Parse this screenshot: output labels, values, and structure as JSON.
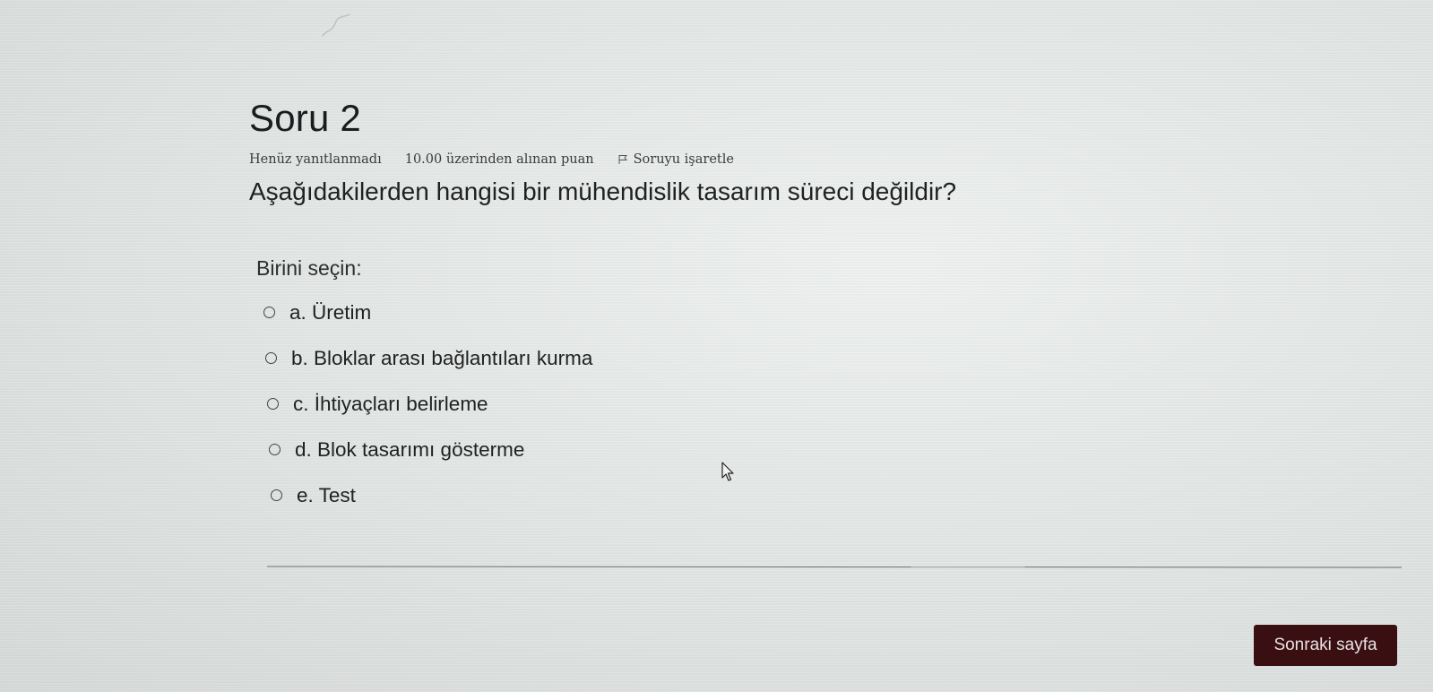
{
  "question": {
    "title": "Soru 2",
    "state": "Henüz yanıtlanmadı",
    "grade": "10.00 üzerinden alınan puan",
    "flag_label": "Soruyu işaretle",
    "text": "Aşağıdakilerden hangisi bir mühendislik tasarım süreci değildir?",
    "prompt": "Birini seçin:",
    "answers": [
      {
        "label": "a. Üretim",
        "selected": false
      },
      {
        "label": "b. Bloklar arası bağlantıları kurma",
        "selected": false
      },
      {
        "label": "c. İhtiyaçları belirleme",
        "selected": false
      },
      {
        "label": "d. Blok tasarımı gösterme",
        "selected": false
      },
      {
        "label": "e. Test",
        "selected": false
      }
    ]
  },
  "navigation": {
    "next_label": "Sonraki sayfa"
  },
  "icons": {
    "flag": "flag-icon",
    "cursor": "mouse-cursor-icon",
    "radio": "radio-button-icon"
  },
  "colors": {
    "next_button_bg": "#3a0f12",
    "next_button_text": "#e8e2e2"
  }
}
